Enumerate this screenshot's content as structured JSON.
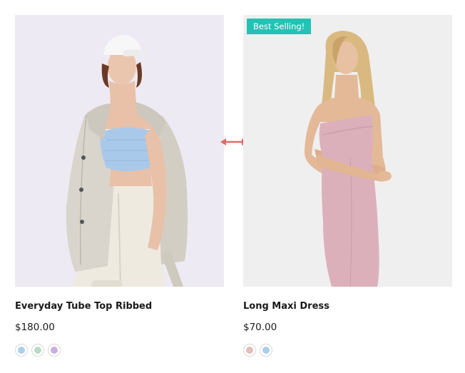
{
  "products": [
    {
      "badge": "",
      "title": "Everyday Tube Top Ribbed",
      "price": "$180.00",
      "swatches": [
        {
          "name": "blue",
          "color": "#a9cfea"
        },
        {
          "name": "green",
          "color": "#b6dcc4"
        },
        {
          "name": "purple",
          "color": "#c8aee0"
        }
      ]
    },
    {
      "badge": "Best Selling!",
      "title": "Long Maxi Dress",
      "price": "$70.00",
      "swatches": [
        {
          "name": "pink",
          "color": "#e6bcbc"
        },
        {
          "name": "blue",
          "color": "#a9cfea"
        }
      ]
    }
  ],
  "colors": {
    "badge_bg": "#22c3b5",
    "arrow": "#e06b6b"
  },
  "icons": {
    "compare": "double-arrow-icon"
  }
}
